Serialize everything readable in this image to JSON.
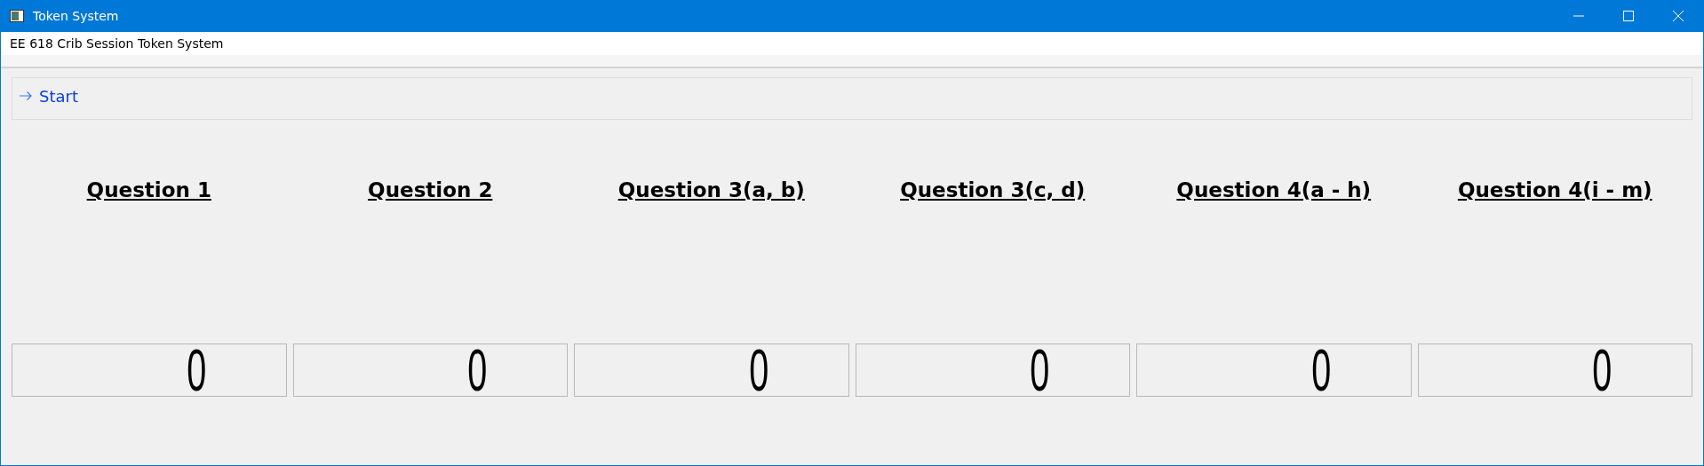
{
  "window": {
    "title": "Token System"
  },
  "header": {
    "text": "EE 618 Crib Session Token System"
  },
  "start_button": {
    "label": "Start"
  },
  "questions": [
    {
      "title": "Question 1",
      "count": "0"
    },
    {
      "title": "Question 2",
      "count": "0"
    },
    {
      "title": "Question 3(a, b)",
      "count": "0"
    },
    {
      "title": "Question 3(c, d)",
      "count": "0"
    },
    {
      "title": "Question 4(a - h)",
      "count": "0"
    },
    {
      "title": "Question 4(i - m)",
      "count": "0"
    }
  ]
}
